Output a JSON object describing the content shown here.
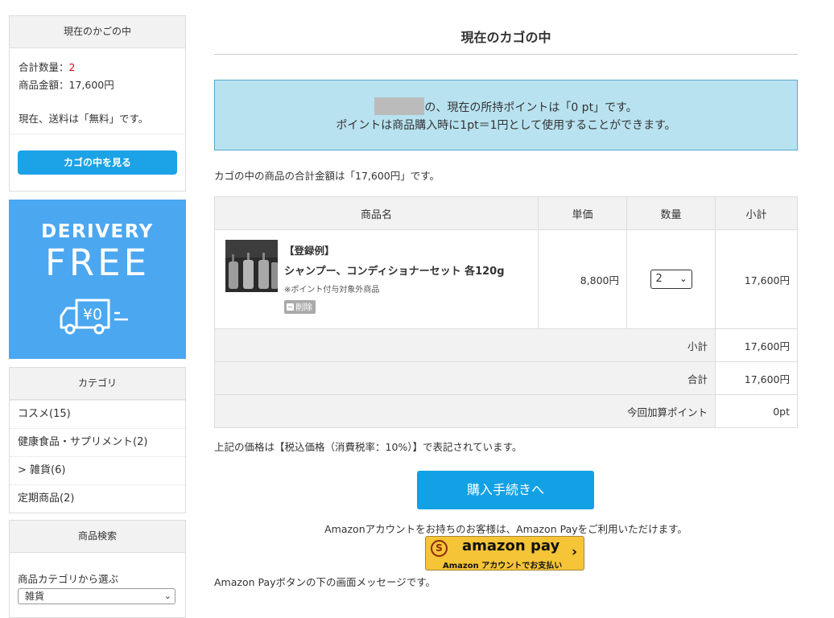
{
  "sidebar": {
    "cart": {
      "title": "現在のかごの中",
      "qty_label": "合計数量：",
      "qty_value": "2",
      "amount": "商品金額：17,600円",
      "shipping": "現在、送料は「無料」です。",
      "view_button": "カゴの中を見る"
    },
    "banner": {
      "line1": "DERIVERY",
      "line2": "FREE",
      "truck_text": "¥0"
    },
    "category": {
      "title": "カテゴリ",
      "items": [
        {
          "label": "コスメ(15)"
        },
        {
          "label": "健康食品・サプリメント(2)"
        },
        {
          "label": "> 雑貨(6)"
        },
        {
          "label": "定期商品(2)"
        }
      ]
    },
    "search": {
      "title": "商品検索",
      "category_label": "商品カテゴリから選ぶ",
      "category_value": "雑貨"
    }
  },
  "main": {
    "title": "現在のカゴの中",
    "points_line1": "の、現在の所持ポイントは「0 pt」です。",
    "points_line2": "ポイントは商品購入時に1pt＝1円として使用することができます。",
    "total_message": "カゴの中の商品の合計金額は「17,600円」です。",
    "table": {
      "headers": {
        "name": "商品名",
        "price": "単価",
        "qty": "数量",
        "subtotal": "小計"
      },
      "item": {
        "tag": "【登録例】",
        "name": "シャンプー、コンディショナーセット 各120g",
        "note": "※ポイント付与対象外商品",
        "delete_label": "削除",
        "price": "8,800円",
        "qty": "2",
        "subtotal": "17,600円"
      },
      "summary": [
        {
          "label": "小計",
          "value": "17,600円"
        },
        {
          "label": "合計",
          "value": "17,600円"
        },
        {
          "label": "今回加算ポイント",
          "value": "0pt"
        }
      ]
    },
    "tax_message": "上記の価格は【税込価格（消費税率：10%）】で表記されています。",
    "purchase_button": "購入手続きへ",
    "amazon": {
      "message": "Amazonアカウントをお持ちのお客様は、Amazon Payをご利用いただけます。",
      "logo": "amazon pay",
      "sub": "Amazon アカウントでお支払い",
      "below_message": "Amazon Payボタンの下の画面メッセージです。"
    }
  },
  "colors": {
    "accent_blue": "#11a1e4",
    "points_bg": "#b8e2f0",
    "banner_bg": "#4ba7f0",
    "red": "#e60012",
    "amazon_yellow": "#f5c437"
  }
}
